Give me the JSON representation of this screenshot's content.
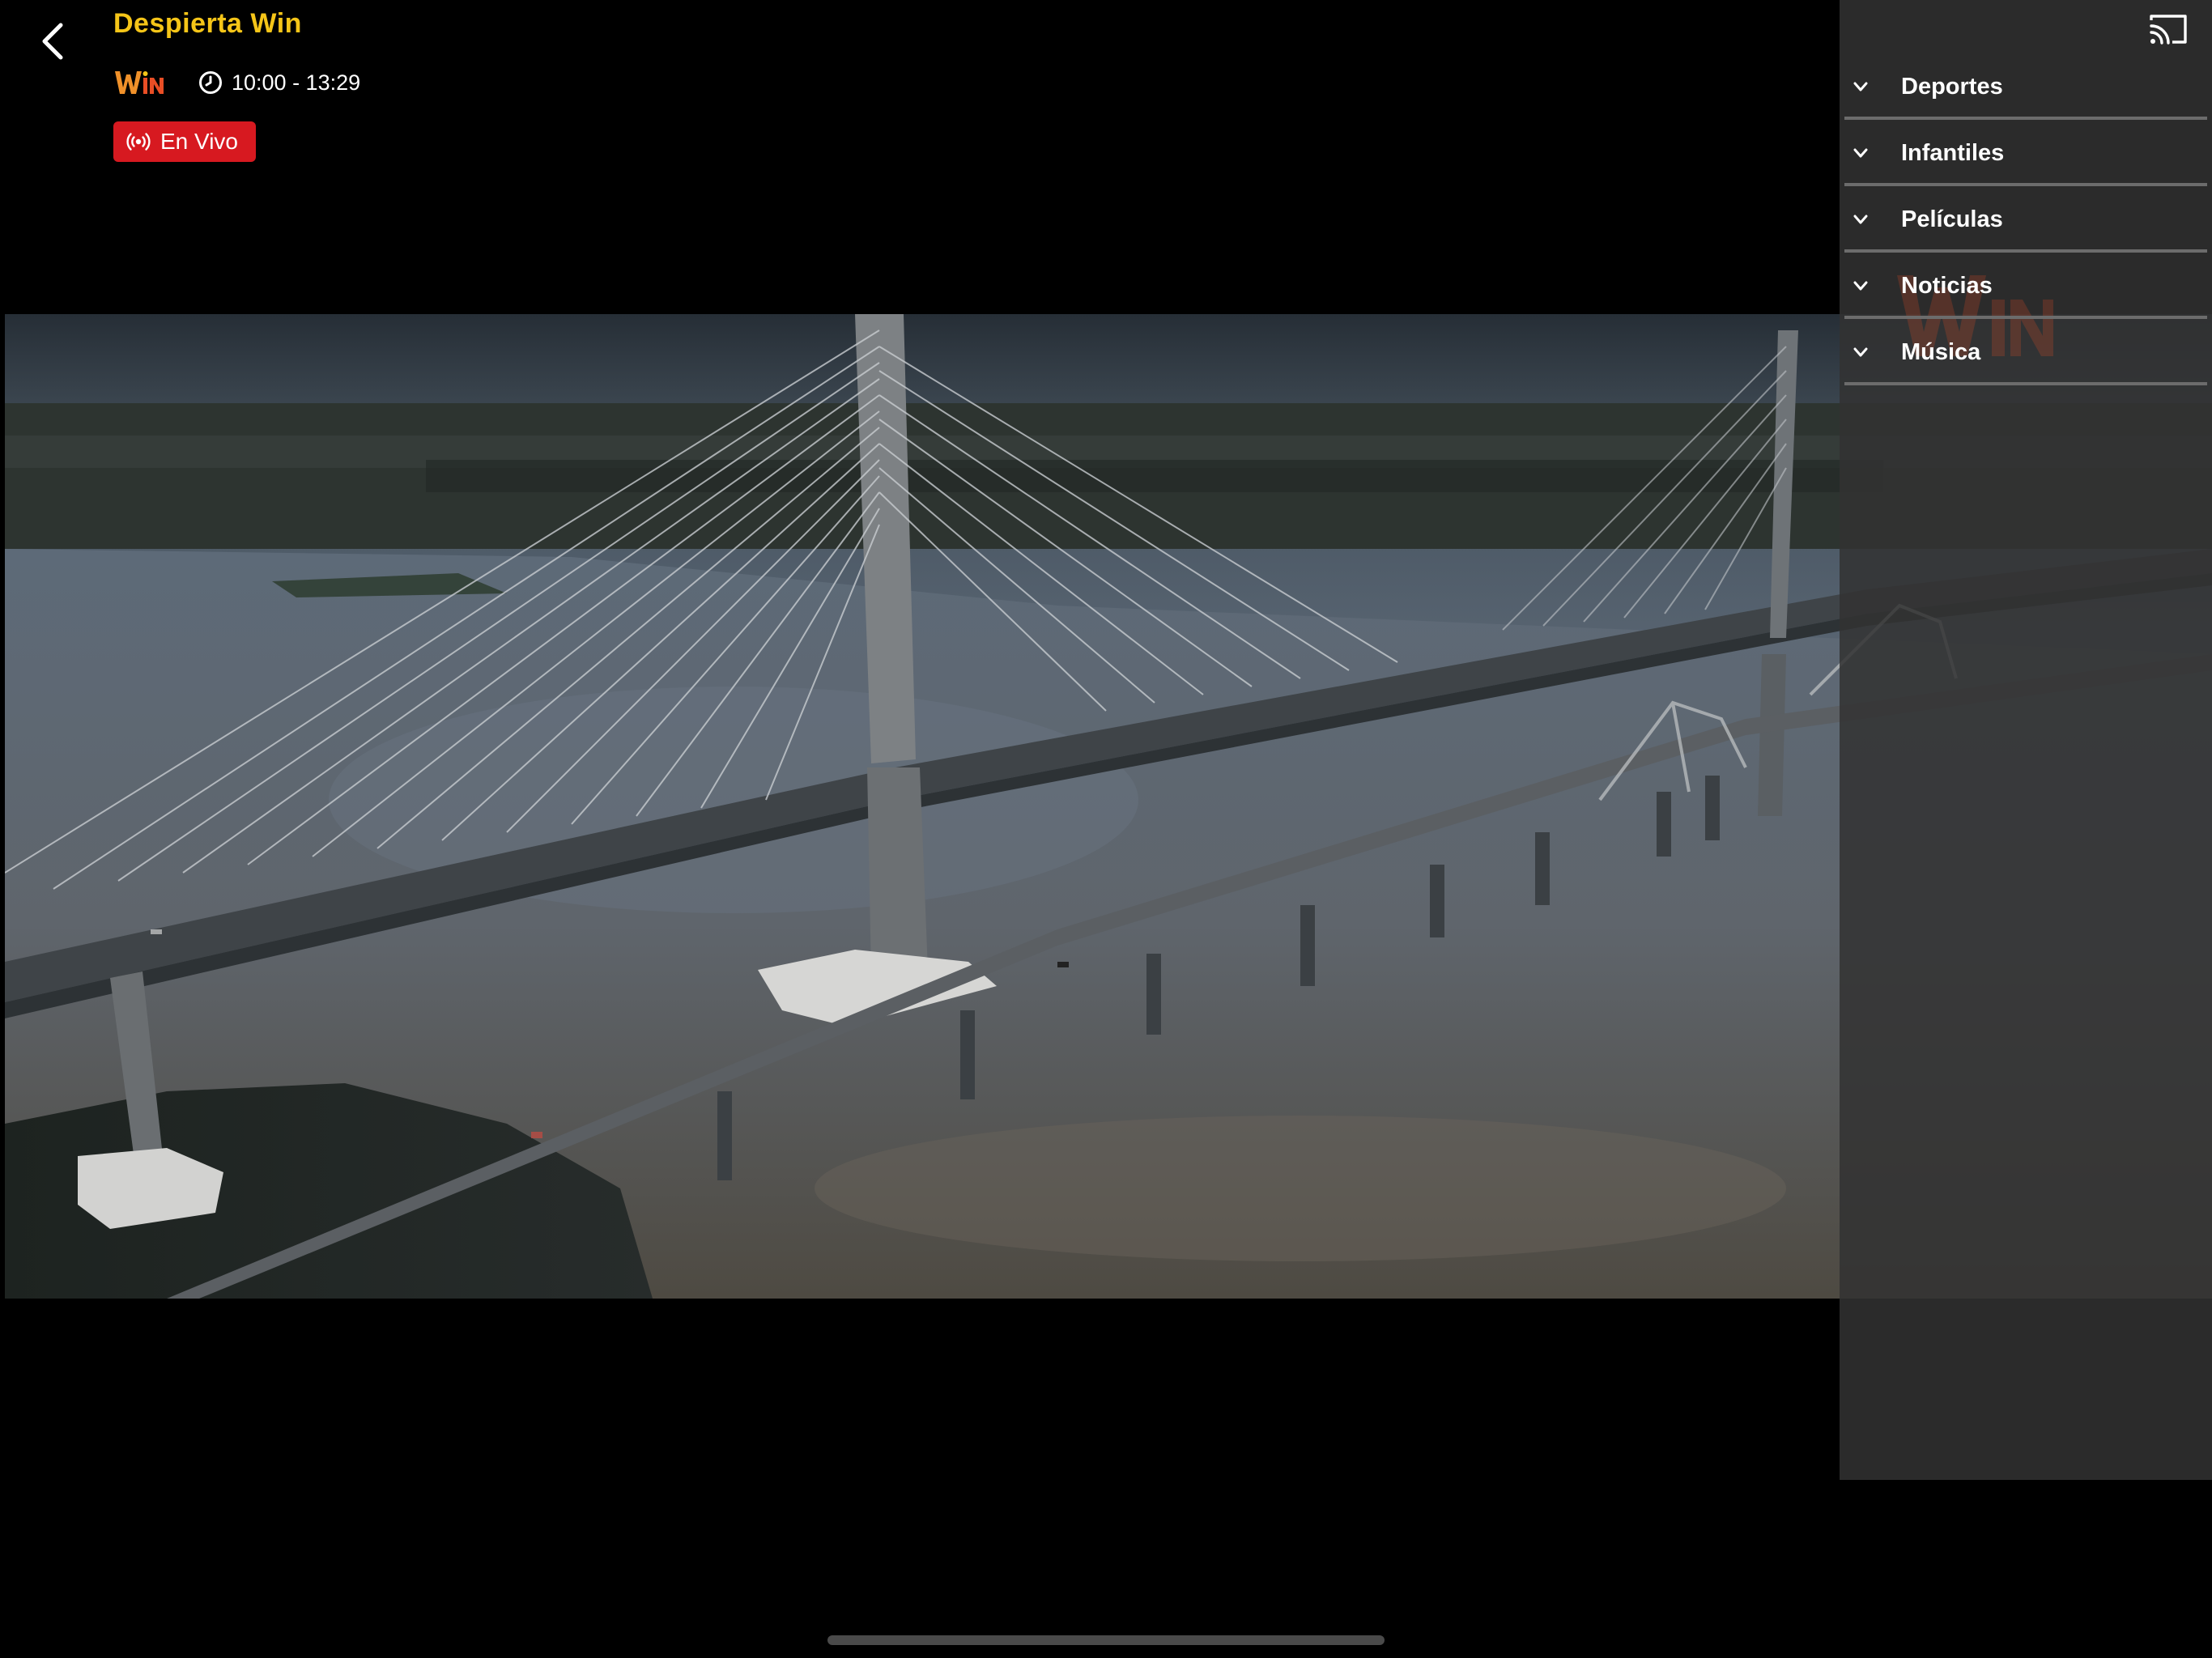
{
  "header": {
    "title": "Despierta Win",
    "schedule": "10:00 - 13:29",
    "live_label": "En Vivo",
    "channel_logo": "win-logo",
    "icons": {
      "back": "chevron-left-icon",
      "clock": "clock-icon",
      "live": "broadcast-icon",
      "cast": "cast-icon"
    }
  },
  "categories": [
    {
      "label": "Deportes",
      "expanded": false
    },
    {
      "label": "Infantiles",
      "expanded": false
    },
    {
      "label": "Películas",
      "expanded": false
    },
    {
      "label": "Noticias",
      "expanded": false
    },
    {
      "label": "Música",
      "expanded": false
    }
  ],
  "colors": {
    "title": "#f5c518",
    "live_badge": "#d71920",
    "panel_bg": "#323232",
    "divider": "#6c6c6c",
    "background": "#000000"
  }
}
